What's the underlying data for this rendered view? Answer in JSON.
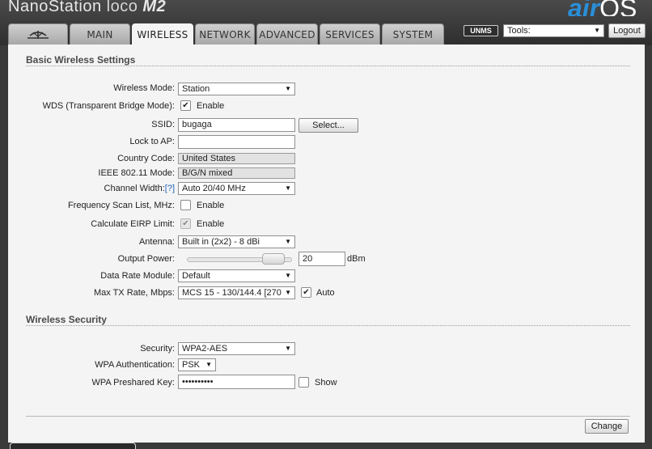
{
  "header": {
    "brand_main": "NanoStation",
    "brand_loco": "loco",
    "brand_model": "M2",
    "airos_air": "air",
    "airos_os": "OS",
    "unms_badge": "UNMS",
    "tools_label": "Tools:",
    "logout_label": "Logout"
  },
  "tabs": [
    {
      "label": "",
      "icon": "ubiquiti-logo-icon"
    },
    {
      "label": "MAIN"
    },
    {
      "label": "WIRELESS",
      "active": true
    },
    {
      "label": "NETWORK"
    },
    {
      "label": "ADVANCED"
    },
    {
      "label": "SERVICES"
    },
    {
      "label": "SYSTEM"
    }
  ],
  "basic": {
    "title": "Basic Wireless Settings",
    "wireless_mode_label": "Wireless Mode:",
    "wireless_mode_value": "Station",
    "wds_label": "WDS (Transparent Bridge Mode):",
    "wds_enable_label": "Enable",
    "ssid_label": "SSID:",
    "ssid_value": "bugaga",
    "select_button": "Select...",
    "lock_ap_label": "Lock to AP:",
    "lock_ap_value": "",
    "country_label": "Country Code:",
    "country_value": "United States",
    "ieee_label": "IEEE 802.11 Mode:",
    "ieee_value": "B/G/N mixed",
    "channel_width_label": "Channel Width:",
    "channel_width_help": "[?]",
    "channel_width_value": "Auto 20/40 MHz",
    "freq_scan_label": "Frequency Scan List, MHz:",
    "freq_scan_enable_label": "Enable",
    "eirp_label": "Calculate EIRP Limit:",
    "eirp_enable_label": "Enable",
    "antenna_label": "Antenna:",
    "antenna_value": "Built in (2x2) - 8 dBi",
    "output_power_label": "Output Power:",
    "output_power_value": "20",
    "output_power_unit": "dBm",
    "data_rate_label": "Data Rate Module:",
    "data_rate_value": "Default",
    "max_tx_label": "Max TX Rate, Mbps:",
    "max_tx_value": "MCS 15 - 130/144.4 [270",
    "max_tx_auto_label": "Auto"
  },
  "security": {
    "title": "Wireless Security",
    "security_label": "Security:",
    "security_value": "WPA2-AES",
    "wpa_auth_label": "WPA Authentication:",
    "wpa_auth_value": "PSK",
    "wpa_key_label": "WPA Preshared Key:",
    "wpa_key_value": "••••••••••",
    "show_label": "Show"
  },
  "footer": {
    "change_button": "Change"
  },
  "colors": {
    "accent_blue": "#2a8fd8",
    "help_link": "#1b64b8",
    "panel_bg": "#f4f4f4",
    "header_bg": "#3a3a3a"
  }
}
